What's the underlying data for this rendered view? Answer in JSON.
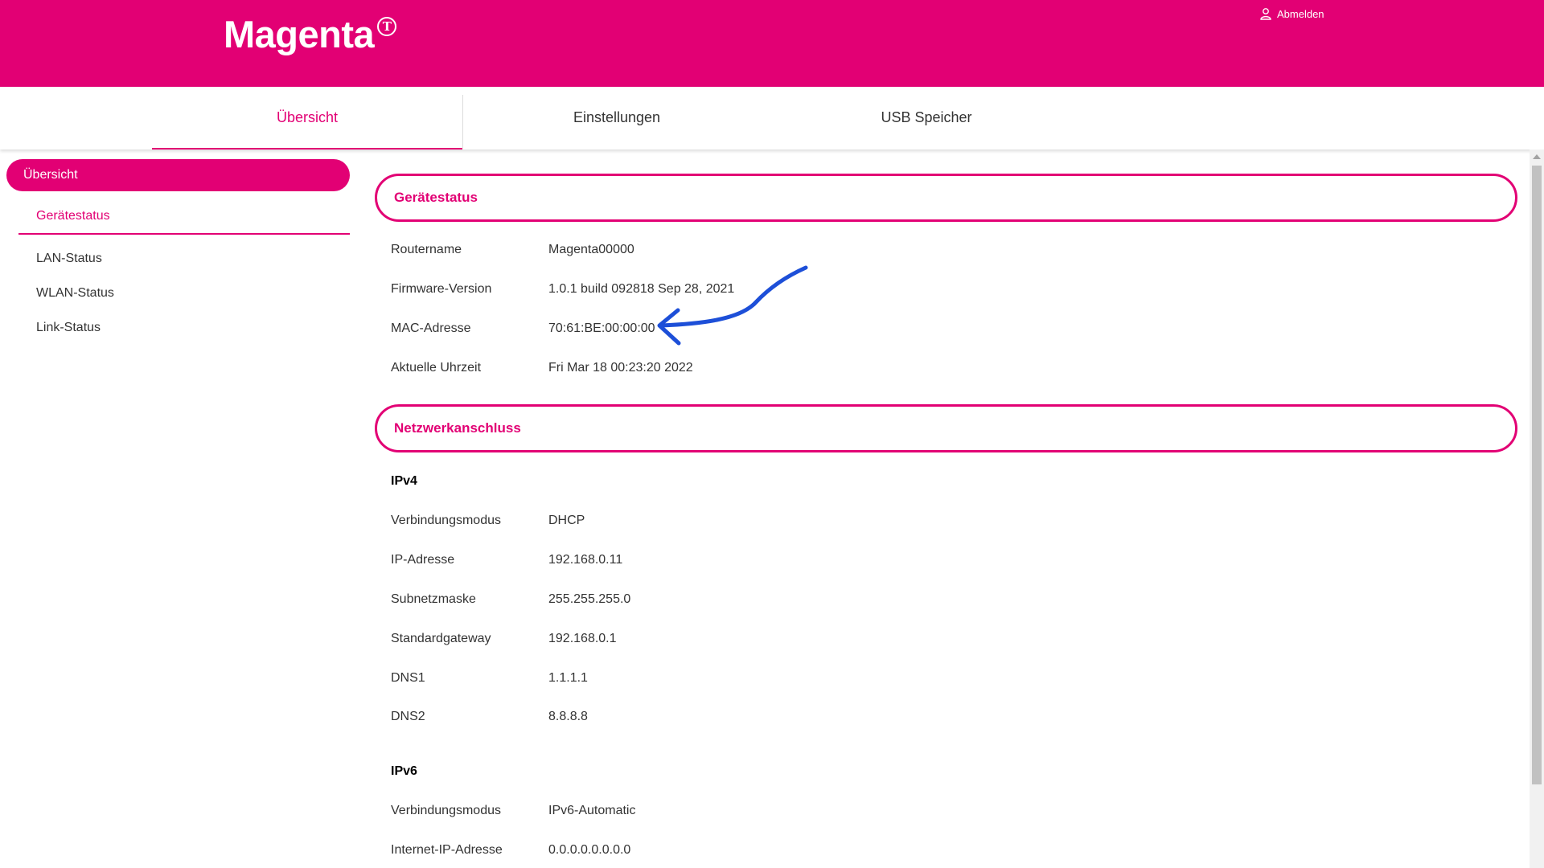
{
  "header": {
    "logo_text": "Magenta",
    "logo_mark": "T",
    "logout_label": "Abmelden",
    "brand_color": "#e20074"
  },
  "tabs": [
    {
      "label": "Übersicht",
      "active": true
    },
    {
      "label": "Einstellungen",
      "active": false
    },
    {
      "label": "USB Speicher",
      "active": false
    }
  ],
  "sidebar": {
    "main_label": "Übersicht",
    "items": [
      {
        "label": "Gerätestatus",
        "active": true
      },
      {
        "label": "LAN-Status",
        "active": false
      },
      {
        "label": "WLAN-Status",
        "active": false
      },
      {
        "label": "Link-Status",
        "active": false
      }
    ]
  },
  "device_status": {
    "title": "Gerätestatus",
    "rows": [
      {
        "label": "Routername",
        "value": "Magenta00000"
      },
      {
        "label": "Firmware-Version",
        "value": "1.0.1 build 092818 Sep 28, 2021"
      },
      {
        "label": "MAC-Adresse",
        "value": "70:61:BE:00:00:00"
      },
      {
        "label": "Aktuelle Uhrzeit",
        "value": "Fri Mar 18 00:23:20 2022"
      }
    ]
  },
  "network": {
    "title": "Netzwerkanschluss",
    "ipv4": {
      "heading": "IPv4",
      "rows": [
        {
          "label": "Verbindungsmodus",
          "value": "DHCP"
        },
        {
          "label": "IP-Adresse",
          "value": "192.168.0.11"
        },
        {
          "label": "Subnetzmaske",
          "value": "255.255.255.0"
        },
        {
          "label": "Standardgateway",
          "value": "192.168.0.1"
        },
        {
          "label": "DNS1",
          "value": "1.1.1.1"
        },
        {
          "label": "DNS2",
          "value": "8.8.8.8"
        }
      ]
    },
    "ipv6": {
      "heading": "IPv6",
      "rows": [
        {
          "label": "Verbindungsmodus",
          "value": "IPv6-Automatic"
        },
        {
          "label": "Internet-IP-Adresse",
          "value": "0.0.0.0.0.0.0.0"
        }
      ]
    }
  },
  "annotation": {
    "color": "#1d4fd8",
    "icon": "arrow-annotation"
  }
}
